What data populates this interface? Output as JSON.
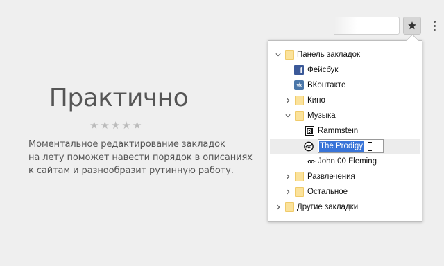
{
  "promo": {
    "title": "Практично",
    "stars": [
      "★",
      "★",
      "★",
      "★",
      "★"
    ],
    "description": [
      "Моментальное редактирование закладок",
      "на лету поможет навести порядок в описаниях",
      "к сайтам и разнообразит рутинную работу."
    ]
  },
  "toolbar": {
    "bookmark_icon": "star-icon",
    "menu_icon": "vertical-dots-icon"
  },
  "bookmarks": {
    "bar": {
      "label": "Панель закладок"
    },
    "facebook": {
      "label": "Фейсбук"
    },
    "vkontakte": {
      "label": "ВКонтакте",
      "icon_text": "vk"
    },
    "kino": {
      "label": "Кино"
    },
    "muzyka": {
      "label": "Музыка"
    },
    "rammstein": {
      "label": "Rammstein",
      "icon_text": "R"
    },
    "prodigy": {
      "label": "The Prodigy"
    },
    "john00": {
      "label": "John 00 Fleming",
      "icon_text": "·oo·"
    },
    "razvlecheniya": {
      "label": "Развлечения"
    },
    "ostalnoe": {
      "label": "Остальное"
    },
    "other": {
      "label": "Другие закладки"
    }
  },
  "colors": {
    "folder": "#fbe29b",
    "selection": "#3874d8",
    "facebook": "#3b5998",
    "vk": "#4a76a8"
  }
}
